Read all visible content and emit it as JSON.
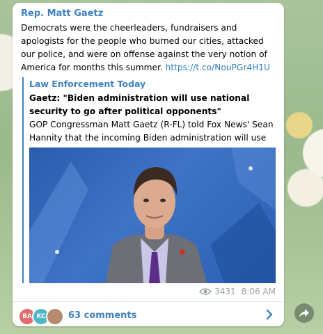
{
  "post": {
    "sender": "Rep. Matt Gaetz",
    "text": "Democrats were the cheerleaders, fundraisers and apologists for the people who burned our cities, attacked our police, and were on offense against the very notion of America for months this summer.",
    "link": "https://t.co/NouPGr4H1U"
  },
  "preview": {
    "site": "Law Enforcement Today",
    "title": "Gaetz: \"Biden administration will use national security to go after political opponents\"",
    "description": "GOP Congressman Matt Gaetz (R-FL) told Fox News' Sean Hannity that the incoming Biden administration will use th..."
  },
  "meta": {
    "views": "3431",
    "time": "8:06 AM"
  },
  "footer": {
    "avatars": [
      {
        "initials": "BA",
        "color": "#e46a6a"
      },
      {
        "initials": "KC",
        "color": "#4fb7c6"
      },
      {
        "initials": "",
        "color": "#b58a6f"
      }
    ],
    "comments_label": "63 comments"
  },
  "colors": {
    "accent": "#3f82c0",
    "link": "#2f7fc1",
    "meta": "#9aa0a6"
  },
  "icons": [
    "eye-icon",
    "chevron-right-icon",
    "share-arrow-icon"
  ]
}
